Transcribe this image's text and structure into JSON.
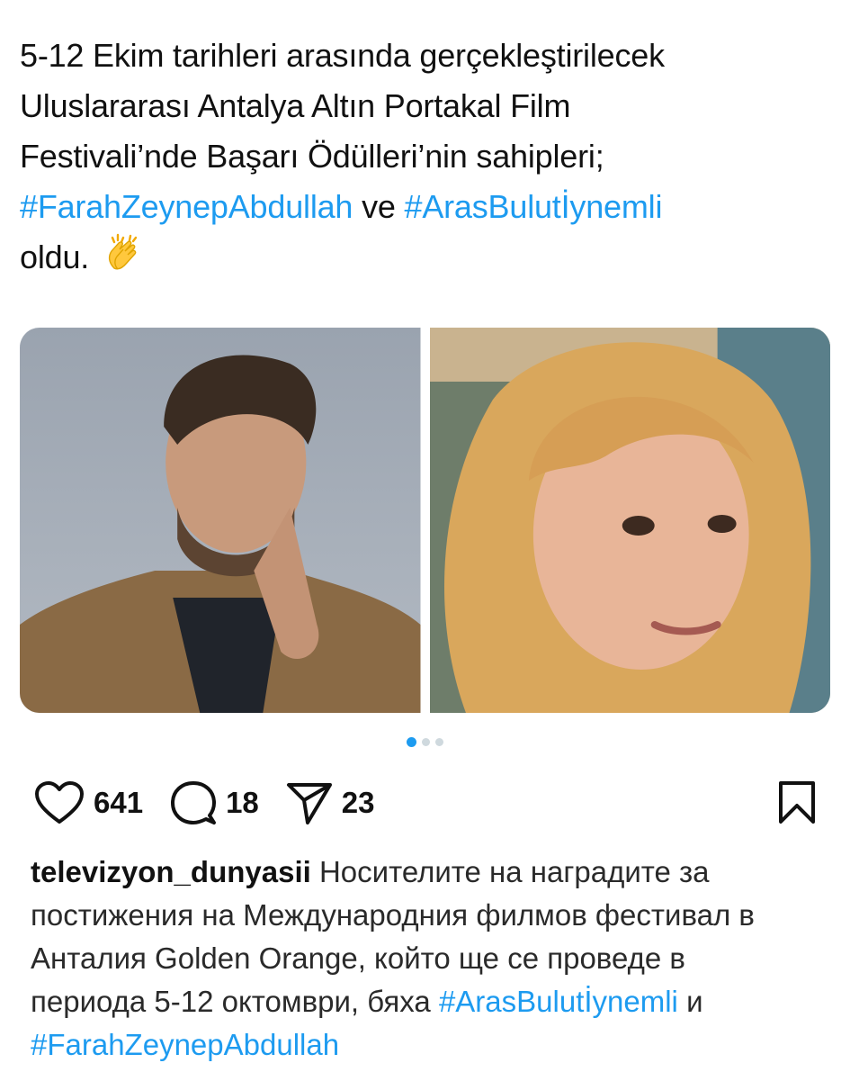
{
  "tweet": {
    "line1": "5-12 Ekim tarihleri arasında gerçekleştirilecek",
    "line2": "Uluslararası Antalya Altın Portakal Film",
    "line3": "Festivali’nde Başarı Ödülleri’nin sahipleri;",
    "hashtag1": "#FarahZeynepAbdullah",
    "connector": "ve",
    "hashtag2": "#ArasBulutİynemli",
    "line5": "oldu.",
    "emoji_name": "clapping-hands-icon"
  },
  "carousel": {
    "photo_count": 3,
    "active_index": 0
  },
  "actions": {
    "likes": "641",
    "comments": "18",
    "shares": "23"
  },
  "caption": {
    "username": "televizyon_dunyasii",
    "text1": "Носителите на наградите за",
    "line2": "постижения на Международния филмов фестивал в",
    "line3": "Анталия Golden Orange, който ще се проведе в",
    "line4_text": "периода 5-12 октомври, бяха",
    "hashtag1": "#ArasBulutİynemli",
    "connector": "и",
    "hashtag2": "#FarahZeynepAbdullah"
  },
  "colors": {
    "link": "#1d9bf0",
    "text": "#111111"
  }
}
